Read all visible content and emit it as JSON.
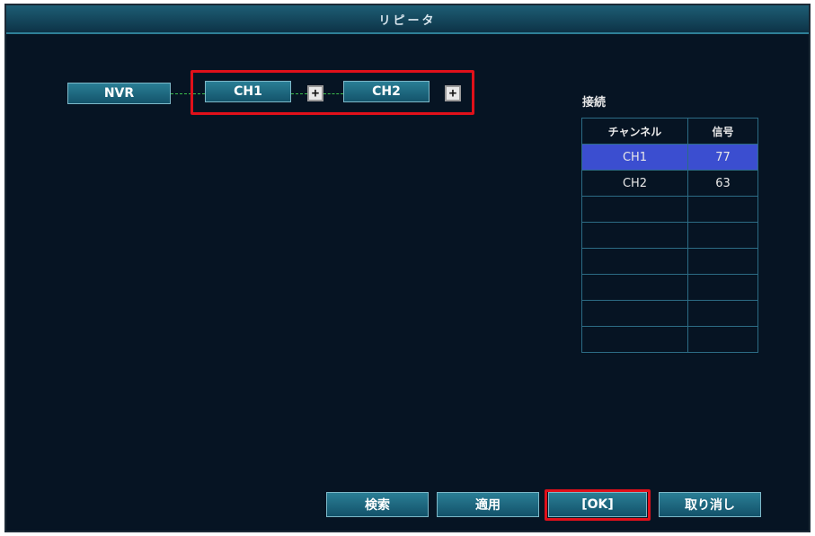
{
  "window": {
    "title": "リピータ"
  },
  "topology": {
    "root_label": "NVR",
    "channels": [
      {
        "label": "CH1",
        "add_icon": "plus-icon"
      },
      {
        "label": "CH2",
        "add_icon": "plus-icon"
      }
    ]
  },
  "connection": {
    "heading": "接続",
    "columns": [
      "チャンネル",
      "信号"
    ],
    "rows": [
      {
        "channel": "CH1",
        "signal": "77",
        "selected": true
      },
      {
        "channel": "CH2",
        "signal": "63",
        "selected": false
      },
      {
        "channel": "",
        "signal": ""
      },
      {
        "channel": "",
        "signal": ""
      },
      {
        "channel": "",
        "signal": ""
      },
      {
        "channel": "",
        "signal": ""
      },
      {
        "channel": "",
        "signal": ""
      },
      {
        "channel": "",
        "signal": ""
      }
    ]
  },
  "footer": {
    "search_label": "検索",
    "apply_label": "適用",
    "ok_label": "[OK]",
    "cancel_label": "取り消し"
  },
  "colors": {
    "background": "#061423",
    "titlebar": "#1d5d74",
    "button": "#2a7e95",
    "selected_row": "#3b4ed0",
    "highlight": "#e0101a",
    "link_line": "#3dc04c"
  }
}
